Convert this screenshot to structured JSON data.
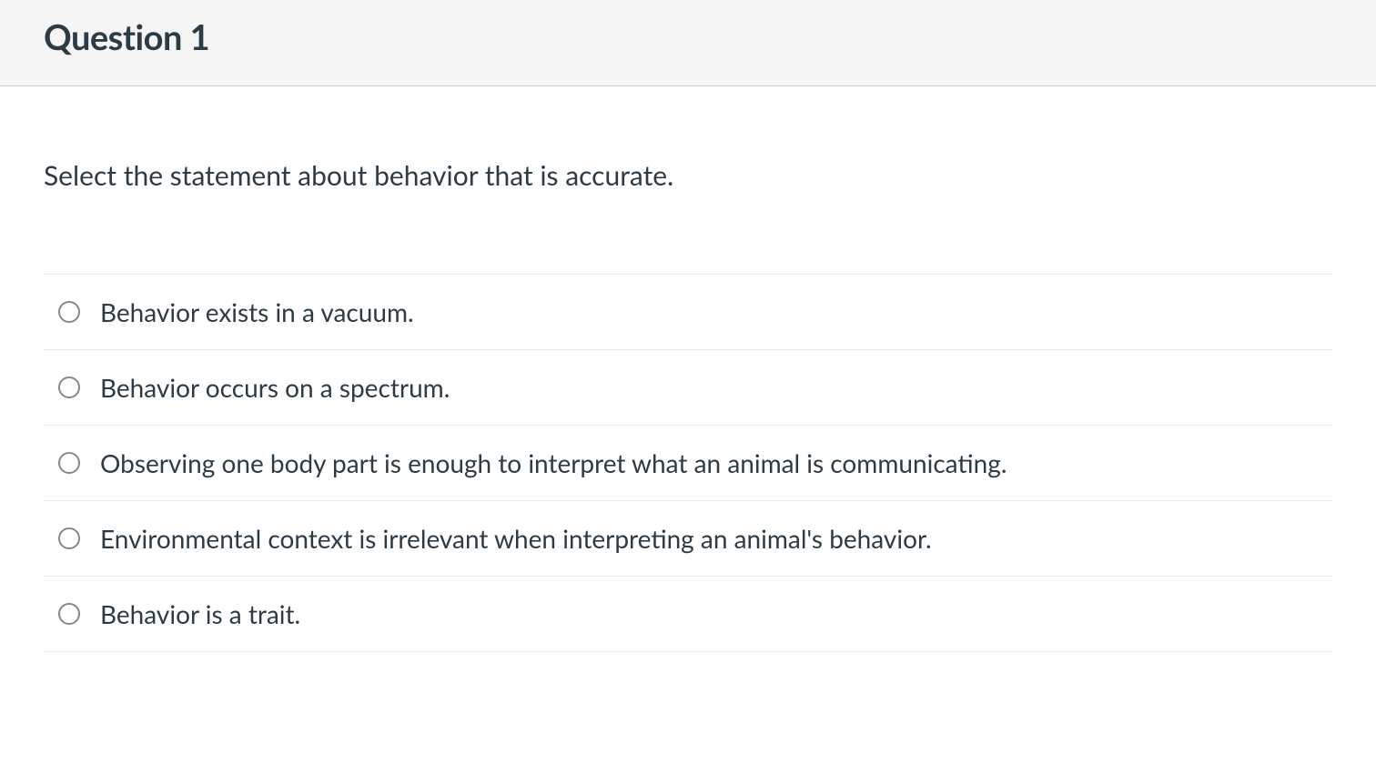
{
  "header": {
    "title": "Question 1"
  },
  "question": {
    "prompt": "Select the statement about behavior that is accurate.",
    "options": [
      {
        "label": "Behavior exists in a vacuum."
      },
      {
        "label": "Behavior occurs on a spectrum."
      },
      {
        "label": "Observing one body part is enough to interpret what an animal is communicating."
      },
      {
        "label": "Environmental context is irrelevant when interpreting an animal's behavior."
      },
      {
        "label": "Behavior is a trait."
      }
    ]
  }
}
